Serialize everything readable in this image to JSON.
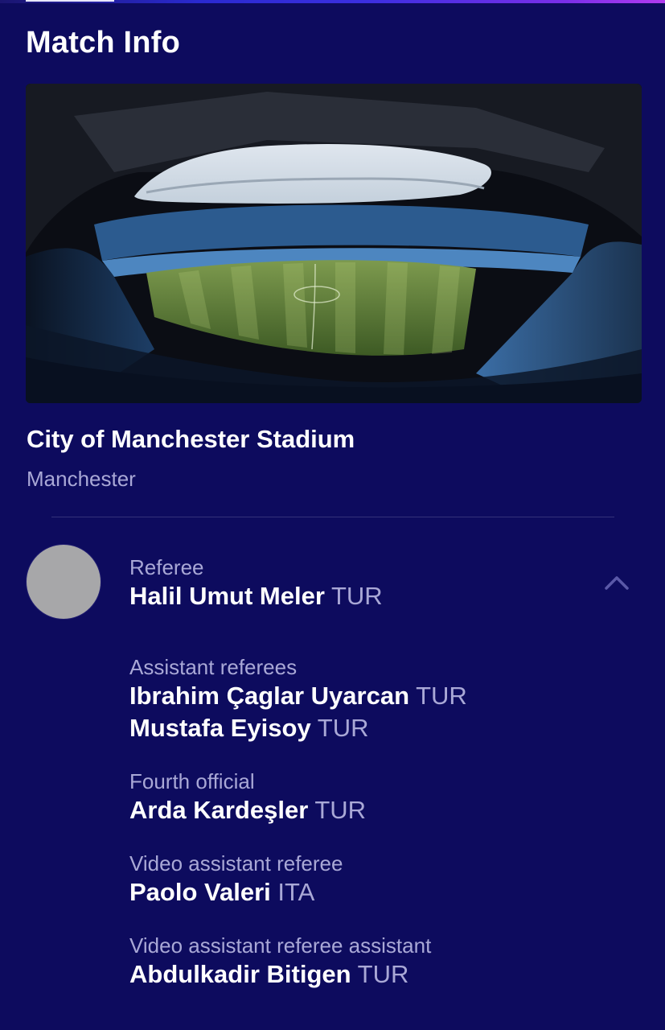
{
  "header": {
    "title": "Match Info"
  },
  "venue": {
    "name": "City of Manchester Stadium",
    "city": "Manchester"
  },
  "icons": {
    "collapse": "chevron-up-icon",
    "avatar": "referee-avatar"
  },
  "colors": {
    "background": "#0d0b5e",
    "secondary_text": "#a9a8d6",
    "avatar_placeholder": "#a7a7a9"
  },
  "officials": {
    "referee": {
      "role": "Referee",
      "people": [
        {
          "name": "Halil Umut Meler",
          "country": "TUR"
        }
      ]
    },
    "assistant_referees": {
      "role": "Assistant referees",
      "people": [
        {
          "name": "Ibrahim Çaglar Uyarcan",
          "country": "TUR"
        },
        {
          "name": "Mustafa Eyisoy",
          "country": "TUR"
        }
      ]
    },
    "fourth_official": {
      "role": "Fourth official",
      "people": [
        {
          "name": "Arda Kardeşler",
          "country": "TUR"
        }
      ]
    },
    "var": {
      "role": "Video assistant referee",
      "people": [
        {
          "name": "Paolo Valeri",
          "country": "ITA"
        }
      ]
    },
    "avar": {
      "role": "Video assistant referee assistant",
      "people": [
        {
          "name": "Abdulkadir Bitigen",
          "country": "TUR"
        }
      ]
    }
  }
}
